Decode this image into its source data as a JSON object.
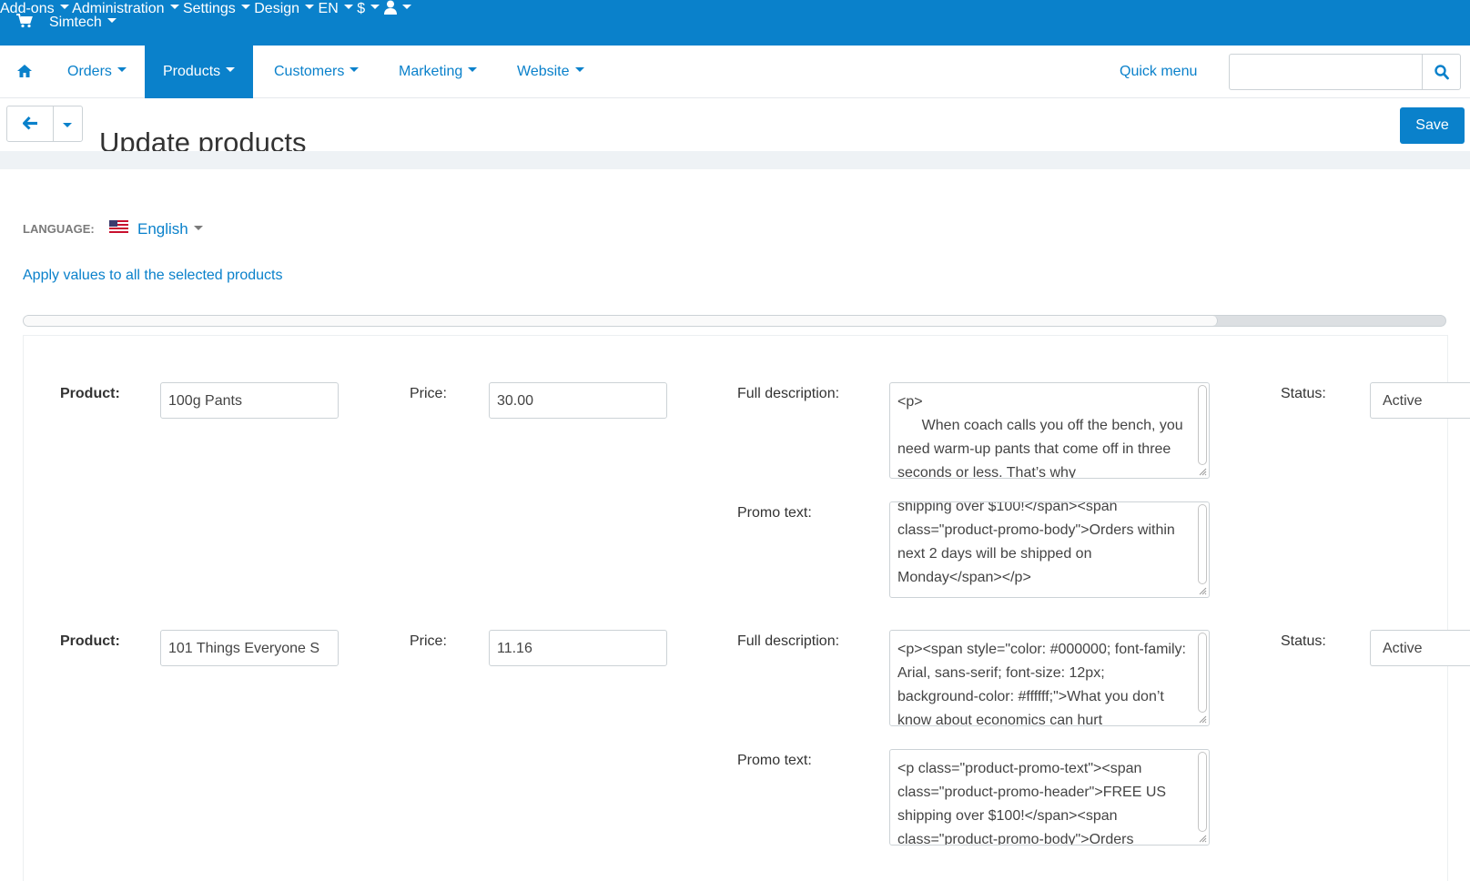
{
  "topbar": {
    "brand": "Simtech",
    "menu": [
      "Add-ons",
      "Administration",
      "Settings",
      "Design",
      "EN",
      "$"
    ]
  },
  "nav": {
    "items": [
      "Orders",
      "Products",
      "Customers",
      "Marketing",
      "Website"
    ],
    "active": "Products",
    "quick_menu": "Quick menu",
    "search_placeholder": ""
  },
  "titlebar": {
    "title": "Update products",
    "save_label": "Save"
  },
  "content": {
    "language_label": "LANGUAGE:",
    "language_value": "English",
    "apply_link": "Apply values to all the selected products",
    "scroll_position": 0.84
  },
  "labels": {
    "product": "Product:",
    "price": "Price:",
    "full_description": "Full description:",
    "promo_text": "Promo text:",
    "status": "Status:"
  },
  "products": [
    {
      "name": "100g Pants",
      "price": "30.00",
      "full_description": "<p>\n      When coach calls you off the bench, you need warm-up pants that come off in three seconds or less. That’s why",
      "promo_text": "shipping over $100!</span><span class=\"product-promo-body\">Orders within next 2 days will be shipped on Monday</span></p>",
      "status": "Active"
    },
    {
      "name": "101 Things Everyone S",
      "price": "11.16",
      "full_description": "<p><span style=\"color: #000000; font-family: Arial, sans-serif; font-size: 12px; background-color: #ffffff;\">What you don’t know about economics can hurt",
      "promo_text": "<p class=\"product-promo-text\"><span class=\"product-promo-header\">FREE US shipping over $100!</span><span class=\"product-promo-body\">Orders",
      "status": "Active"
    }
  ],
  "colors": {
    "primary": "#0a81cb",
    "border": "#ccd2d6",
    "band": "#eef2f5"
  }
}
